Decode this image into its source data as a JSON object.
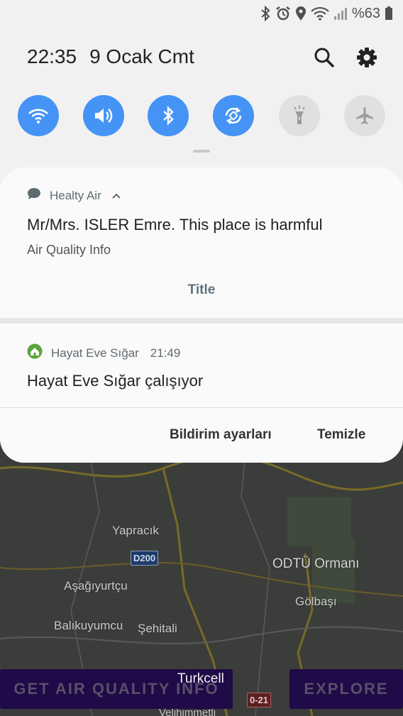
{
  "status_bar": {
    "battery_text": "%63",
    "icons": [
      "bluetooth-icon",
      "alarm-icon",
      "location-icon",
      "wifi-icon",
      "signal-icon",
      "battery-icon"
    ]
  },
  "header": {
    "time": "22:35",
    "date": "9 Ocak Cmt"
  },
  "quick_settings": [
    {
      "name": "wifi",
      "state": "on"
    },
    {
      "name": "sound",
      "state": "on"
    },
    {
      "name": "bluetooth",
      "state": "on"
    },
    {
      "name": "auto-rotate",
      "state": "on"
    },
    {
      "name": "flashlight",
      "state": "off"
    },
    {
      "name": "airplane-mode",
      "state": "off"
    }
  ],
  "notifications": [
    {
      "app_name": "Healty Air",
      "title": "Mr/Mrs. ISLER Emre. This place is harmful",
      "body": "Air Quality Info",
      "action": "Title"
    },
    {
      "app_name": "Hayat Eve Sığar",
      "time": "21:49",
      "title": "Hayat Eve Sığar çalışıyor"
    }
  ],
  "footer": {
    "settings_label": "Bildirim ayarları",
    "clear_label": "Temizle"
  },
  "background_app": {
    "map_labels": [
      "Yapracık",
      "D200",
      "Aşağıyurtçu",
      "ODTÜ Ormanı",
      "Gölbaşı",
      "Balıkuyumcu",
      "Şehitali",
      "0-21",
      "Velihimmetli"
    ],
    "left_button": "GET AIR QUALITY INFO",
    "right_button": "EXPLORE",
    "carrier": "Turkcell"
  },
  "colors": {
    "accent": "#4593f5",
    "shade": "#f1f1f1",
    "card": "#fafafa",
    "app_button": "#200a48"
  }
}
